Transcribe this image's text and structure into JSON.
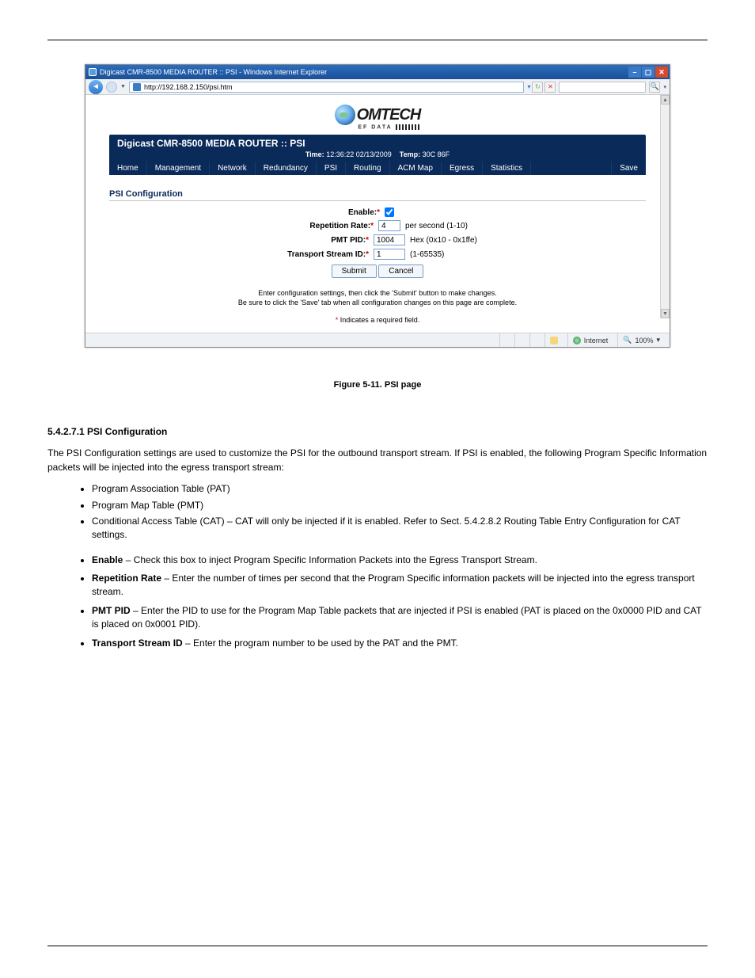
{
  "browser": {
    "window_title": "Digicast CMR-8500 MEDIA ROUTER :: PSI - Windows Internet Explorer",
    "url": "http://192.168.2.150/psi.htm",
    "go_arrow": "▾",
    "refresh": "↻",
    "stop": "✕",
    "status_zone": "Internet",
    "zoom": "100%"
  },
  "logo": {
    "brand": "OMTECH",
    "subline": "EF DATA"
  },
  "header": {
    "title": "Digicast CMR-8500 MEDIA ROUTER :: PSI",
    "time_label": "Time:",
    "time_value": "12:36:22 02/13/2009",
    "temp_label": "Temp:",
    "temp_value": "30C 86F"
  },
  "tabs": [
    "Home",
    "Management",
    "Network",
    "Redundancy",
    "PSI",
    "Routing",
    "ACM Map",
    "Egress",
    "Statistics",
    "Save"
  ],
  "section_title": "PSI Configuration",
  "form": {
    "enable": {
      "label": "Enable:",
      "checked": true
    },
    "rep_rate": {
      "label": "Repetition Rate:",
      "value": "4",
      "hint": "per second (1-10)"
    },
    "pmt_pid": {
      "label": "PMT PID:",
      "value": "1004",
      "hint": "Hex (0x10 - 0x1ffe)"
    },
    "ts_id": {
      "label": "Transport Stream ID:",
      "value": "1",
      "hint": "(1-65535)"
    },
    "submit": "Submit",
    "cancel": "Cancel"
  },
  "help": {
    "line1": "Enter configuration settings, then click the 'Submit' button to make changes.",
    "line2": "Be sure to click the 'Save' tab when all configuration changes on this page are complete.",
    "required": "Indicates a required field."
  },
  "doc": {
    "caption": "Figure 5-11. PSI page",
    "intro_strong": "5.4.2.7.1 PSI Configuration",
    "p1": "The PSI Configuration settings are used to customize the PSI for the outbound transport stream. If PSI is enabled, the following Program Specific Information packets will be injected into the egress transport stream:",
    "bullets1": [
      "Program Association Table (PAT)",
      "Program Map Table (PMT)",
      "Conditional Access Table (CAT) – CAT will only be injected if it is enabled. Refer to Sect. 5.4.2.8.2 Routing Table Entry Configuration for CAT settings."
    ],
    "bullets2": [
      {
        "name": "Enable",
        "text": " – Check this box to inject Program Specific Information Packets into the Egress Transport Stream."
      },
      {
        "name": "Repetition Rate",
        "text": " – Enter the number of times per second that the Program Specific information packets will be injected into the egress transport stream."
      },
      {
        "name": "PMT PID",
        "text": " – Enter the PID to use for the Program Map Table packets that are injected if PSI is enabled (PAT is placed on the 0x0000 PID and CAT is placed on 0x0001 PID)."
      },
      {
        "name": "Transport Stream ID",
        "text": " – Enter the program number to be used by the PAT and the PMT."
      }
    ]
  }
}
